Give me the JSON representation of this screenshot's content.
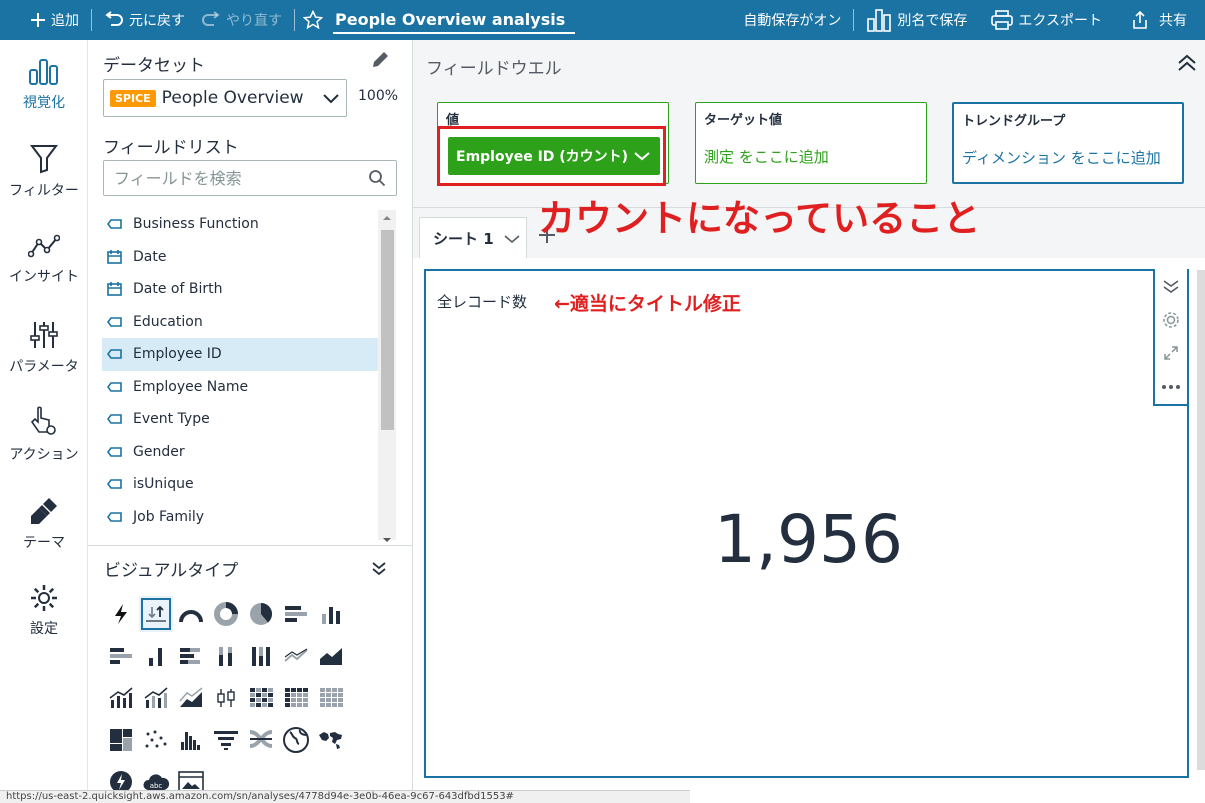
{
  "topbar": {
    "add": "追加",
    "undo": "元に戻す",
    "redo": "やり直す",
    "analysis_title": "People Overview analysis",
    "autosave": "自動保存がオン",
    "save_as": "別名で保存",
    "export": "エクスポート",
    "share": "共有"
  },
  "leftnav": {
    "visualize": "視覚化",
    "filter": "フィルター",
    "insights": "インサイト",
    "parameters": "パラメータ",
    "actions": "アクション",
    "themes": "テーマ",
    "settings": "設定"
  },
  "datapanel": {
    "dataset_label": "データセット",
    "spice_badge": "SPICE",
    "dataset_name": "People Overview",
    "spice_pct": "100%",
    "field_list_label": "フィールドリスト",
    "search_placeholder": "フィールドを検索",
    "fields": [
      {
        "name": "Business Function",
        "type": "dimension"
      },
      {
        "name": "Date",
        "type": "date"
      },
      {
        "name": "Date of Birth",
        "type": "date"
      },
      {
        "name": "Education",
        "type": "dimension"
      },
      {
        "name": "Employee ID",
        "type": "dimension",
        "selected": true
      },
      {
        "name": "Employee Name",
        "type": "dimension"
      },
      {
        "name": "Event Type",
        "type": "dimension"
      },
      {
        "name": "Gender",
        "type": "dimension"
      },
      {
        "name": "isUnique",
        "type": "dimension"
      },
      {
        "name": "Job Family",
        "type": "dimension"
      }
    ],
    "visual_types_label": "ビジュアルタイプ"
  },
  "fieldwell": {
    "title": "フィールドウエル",
    "value_label": "値",
    "value_pill": "Employee ID (カウント)",
    "target_label": "ターゲット値",
    "target_placeholder": "測定 をここに追加",
    "trend_label": "トレンドグループ",
    "trend_placeholder": "ディメンション をここに追加"
  },
  "annotations": {
    "count_note": "カウントになっていること",
    "title_note": "←適当にタイトル修正"
  },
  "sheets": {
    "tab1": "シート 1"
  },
  "visual": {
    "title": "全レコード数",
    "kpi_value": "1,956"
  },
  "statusbar": {
    "url": "https://us-east-2.quicksight.aws.amazon.com/sn/analyses/4778d94e-3e0b-46ea-9c67-643dfbd1553#"
  },
  "colors": {
    "topbar": "#1a73a3",
    "accent": "#1a73a3",
    "measure_green": "#2ea11a",
    "annotation_red": "#e02020"
  }
}
